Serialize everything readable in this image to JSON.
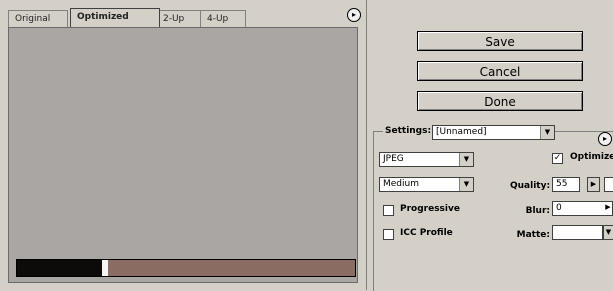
{
  "tabs": {
    "original": "Original",
    "optimized": "Optimized",
    "two_up": "2-Up",
    "four_up": "4-Up",
    "active": "optimized"
  },
  "preview": {
    "canvas_color": "#a9a6a3",
    "progress_fraction": 0.25,
    "progress_track_color": "#8b6c63",
    "progress_fill_color": "#0d0b0a"
  },
  "buttons": {
    "save": "Save",
    "cancel": "Cancel",
    "done": "Done"
  },
  "settings": {
    "label": "Settings:",
    "value": "[Unnamed]",
    "format": "JPEG",
    "compression": "Medium",
    "progressive_label": "Progressive",
    "progressive_checked": false,
    "icc_label": "ICC Profile",
    "icc_checked": false,
    "optimized_label": "Optimized",
    "optimized_checked": true,
    "quality_label": "Quality:",
    "quality_value": "55",
    "blur_label": "Blur:",
    "blur_value": "0",
    "matte_label": "Matte:",
    "matte_value": ""
  },
  "icons": {
    "menu": "right-arrow-circle-icon",
    "dropdown": "down-triangle-icon",
    "check": "checkmark-icon"
  },
  "colors": {
    "panel_bg": "#d4d0c8"
  }
}
